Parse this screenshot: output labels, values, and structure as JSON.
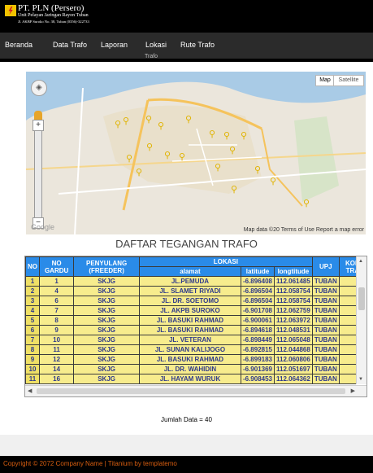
{
  "header": {
    "company": "PT. PLN (Persero)",
    "unit": "Unit Pelayan Jaringan Rayon Tuban",
    "address": "Jl. AKBP Suroko No. 38, Tuban (0356)-322733"
  },
  "nav": {
    "items": [
      "Beranda",
      "Data Trafo",
      "Laporan",
      "Lokasi",
      "Rute Trafo"
    ],
    "sub_label": "Trafo"
  },
  "map": {
    "map_button": "Map",
    "satellite_button": "Satellite",
    "credit": "Map data ©20  Terms of Use   Report a map error",
    "logo": "Google"
  },
  "section_title": "DAFTAR TEGANGAN TRAFO",
  "table": {
    "headers": {
      "no": "NO",
      "no_gardu": "NO GARDU",
      "penyulang": "PENYULANG (FREEDER)",
      "lokasi": "LOKASI",
      "alamat": "alamat",
      "latitude": "latitude",
      "longtitude": "longtitude",
      "upj": "UPJ",
      "kon": "KON TRA"
    },
    "rows": [
      {
        "no": "1",
        "gardu": "1",
        "penyulang": "SKJG",
        "alamat": "JL.PEMUDA",
        "lat": "-6.896408",
        "lon": "112.061485",
        "upj": "TUBAN"
      },
      {
        "no": "2",
        "gardu": "4",
        "penyulang": "SKJG",
        "alamat": "JL. SLAMET RIYADI",
        "lat": "-6.896504",
        "lon": "112.058754",
        "upj": "TUBAN"
      },
      {
        "no": "3",
        "gardu": "6",
        "penyulang": "SKJG",
        "alamat": "JL. DR. SOETOMO",
        "lat": "-6.896504",
        "lon": "112.058754",
        "upj": "TUBAN"
      },
      {
        "no": "4",
        "gardu": "7",
        "penyulang": "SKJG",
        "alamat": "JL. AKPB SUROKO",
        "lat": "-6.901708",
        "lon": "112.062759",
        "upj": "TUBAN"
      },
      {
        "no": "5",
        "gardu": "8",
        "penyulang": "SKJG",
        "alamat": "JL. BASUKI RAHMAD",
        "lat": "-6.900061",
        "lon": "112.063972",
        "upj": "TUBAN"
      },
      {
        "no": "6",
        "gardu": "9",
        "penyulang": "SKJG",
        "alamat": "JL. BASUKI RAHMAD",
        "lat": "-6.894618",
        "lon": "112.048531",
        "upj": "TUBAN"
      },
      {
        "no": "7",
        "gardu": "10",
        "penyulang": "SKJG",
        "alamat": "JL. VETERAN",
        "lat": "-6.898449",
        "lon": "112.065048",
        "upj": "TUBAN"
      },
      {
        "no": "8",
        "gardu": "11",
        "penyulang": "SKJG",
        "alamat": "JL. SUNAN KALIJOGO",
        "lat": "-6.892815",
        "lon": "112.044868",
        "upj": "TUBAN"
      },
      {
        "no": "9",
        "gardu": "12",
        "penyulang": "SKJG",
        "alamat": "JL. BASUKI RAHMAD",
        "lat": "-6.899183",
        "lon": "112.060806",
        "upj": "TUBAN"
      },
      {
        "no": "10",
        "gardu": "14",
        "penyulang": "SKJG",
        "alamat": "JL. DR. WAHIDIN",
        "lat": "-6.901369",
        "lon": "112.051697",
        "upj": "TUBAN"
      },
      {
        "no": "11",
        "gardu": "16",
        "penyulang": "SKJG",
        "alamat": "JL. HAYAM WURUK",
        "lat": "-6.908453",
        "lon": "112.064362",
        "upj": "TUBAN"
      }
    ]
  },
  "jumlah": "Jumlah Data = 40",
  "footer": "Copyright © 2072 Company Name | Titanium by templatemo",
  "colors": {
    "header_bg": "#000000",
    "nav_bg": "#2b2b2b",
    "table_header": "#2a8be8",
    "table_cell": "#f7ec8d",
    "footer_text": "#d85e10"
  }
}
